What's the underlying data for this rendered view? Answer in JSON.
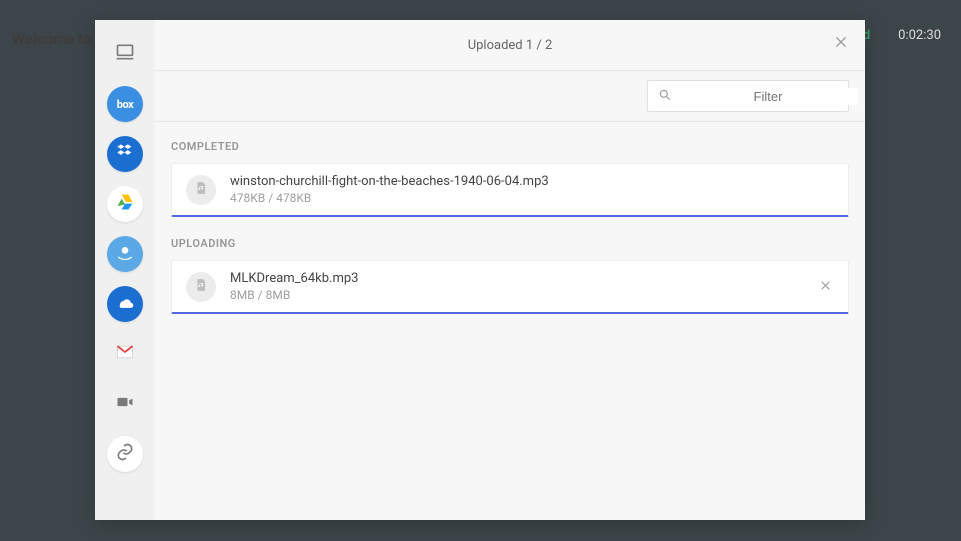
{
  "background": {
    "welcome": "Welcome to",
    "status_green": "ibed",
    "timer": "0:02:30"
  },
  "modal": {
    "title": "Uploaded 1 / 2",
    "search_placeholder": "Filter"
  },
  "sources": [
    {
      "id": "device",
      "name": "device-icon"
    },
    {
      "id": "box",
      "name": "box-icon"
    },
    {
      "id": "dropbox",
      "name": "dropbox-icon"
    },
    {
      "id": "gdrive",
      "name": "google-drive-icon"
    },
    {
      "id": "amazon",
      "name": "amazon-cloud-icon"
    },
    {
      "id": "onedrive",
      "name": "onedrive-icon"
    },
    {
      "id": "gmail",
      "name": "gmail-icon"
    },
    {
      "id": "video",
      "name": "video-icon"
    },
    {
      "id": "link",
      "name": "link-icon"
    }
  ],
  "sections": {
    "completed_label": "COMPLETED",
    "uploading_label": "UPLOADING"
  },
  "completed": [
    {
      "name": "winston-churchill-fight-on-the-beaches-1940-06-04.mp3",
      "size": "478KB / 478KB"
    }
  ],
  "uploading": [
    {
      "name": "MLKDream_64kb.mp3",
      "size": "8MB / 8MB"
    }
  ]
}
